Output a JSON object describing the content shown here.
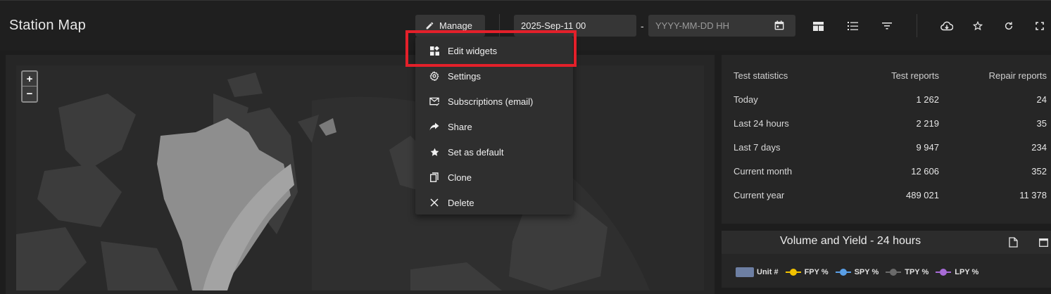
{
  "header": {
    "title": "Station Map",
    "manage_label": "Manage",
    "date_from_value": "2025-Sep-11 00",
    "date_separator": "-",
    "date_to_placeholder": "YYYY-MM-DD HH"
  },
  "toolbar_icons": [
    "layout-icon",
    "list-icon",
    "filter-icon",
    "cloud-download-icon",
    "star-icon",
    "refresh-icon",
    "fullscreen-icon"
  ],
  "map": {
    "zoom_in": "+",
    "zoom_out": "−"
  },
  "manage_menu": {
    "items": [
      {
        "label": "Edit widgets",
        "icon": "widgets-icon"
      },
      {
        "label": "Settings",
        "icon": "gear-icon"
      },
      {
        "label": "Subscriptions (email)",
        "icon": "mail-icon"
      },
      {
        "label": "Share",
        "icon": "share-icon"
      },
      {
        "label": "Set as default",
        "icon": "star-icon"
      },
      {
        "label": "Clone",
        "icon": "copy-icon"
      },
      {
        "label": "Delete",
        "icon": "close-icon"
      }
    ]
  },
  "test_statistics": {
    "columns": [
      "Test statistics",
      "Test reports",
      "Repair reports"
    ],
    "rows": [
      {
        "period": "Today",
        "test_reports": "1 262",
        "repair_reports": "24"
      },
      {
        "period": "Last 24 hours",
        "test_reports": "2 219",
        "repair_reports": "35"
      },
      {
        "period": "Last 7 days",
        "test_reports": "9 947",
        "repair_reports": "234"
      },
      {
        "period": "Current month",
        "test_reports": "12 606",
        "repair_reports": "352"
      },
      {
        "period": "Current year",
        "test_reports": "489 021",
        "repair_reports": "11 378"
      }
    ]
  },
  "volume_yield": {
    "title": "Volume and Yield - 24 hours",
    "legend": [
      {
        "label": "Unit #",
        "color": "#6d7fa3",
        "kind": "bar"
      },
      {
        "label": "FPY %",
        "color": "#f2c200",
        "kind": "line"
      },
      {
        "label": "SPY %",
        "color": "#5a9fe6",
        "kind": "line"
      },
      {
        "label": "TPY %",
        "color": "#6a6a6a",
        "kind": "line"
      },
      {
        "label": "LPY %",
        "color": "#a76bd6",
        "kind": "line"
      }
    ]
  },
  "colors": {
    "highlight": "#e3202a",
    "background": "#1d1d1d",
    "panel": "#262626"
  }
}
